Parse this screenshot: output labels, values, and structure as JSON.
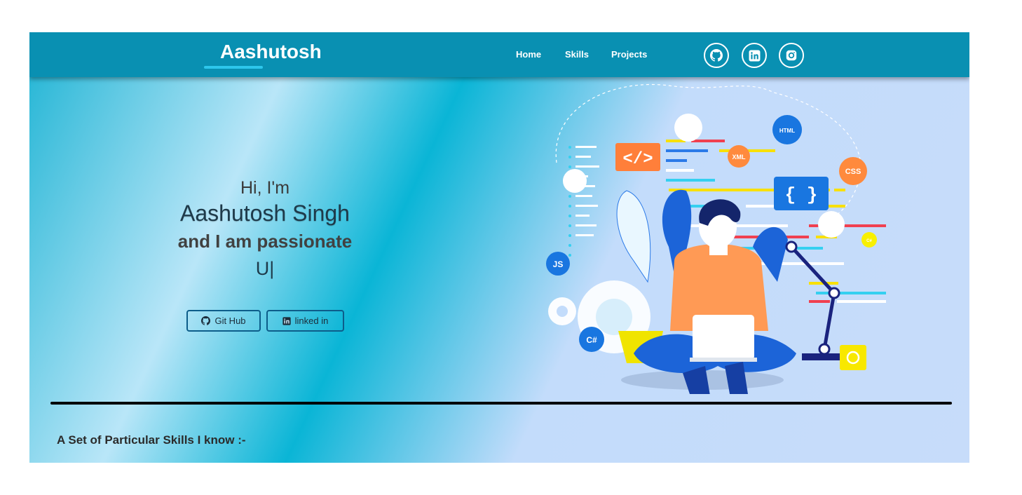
{
  "navbar": {
    "brand": "Aashutosh",
    "links": [
      {
        "label": "Home"
      },
      {
        "label": "Skills"
      },
      {
        "label": "Projects"
      }
    ],
    "social": [
      {
        "icon": "github-icon"
      },
      {
        "icon": "linkedin-icon"
      },
      {
        "icon": "instagram-icon"
      }
    ]
  },
  "hero": {
    "greeting": "Hi, I'm",
    "name": "Aashutosh Singh",
    "tagline": "and I am passionate",
    "typed": "U",
    "cursor": "|",
    "buttons": {
      "github": "Git Hub",
      "linkedin": "linked in"
    }
  },
  "illustration": {
    "badges": [
      "HTML",
      "XML",
      "CSS",
      "JS",
      "C#",
      "C#"
    ],
    "code_tag": "</>",
    "braces": "{ }"
  },
  "skills": {
    "heading": "A Set of Particular Skills I know :-"
  },
  "colors": {
    "navbar": "#0990b2",
    "accent": "#2ec7ec",
    "button_border": "#0d5d8a"
  }
}
